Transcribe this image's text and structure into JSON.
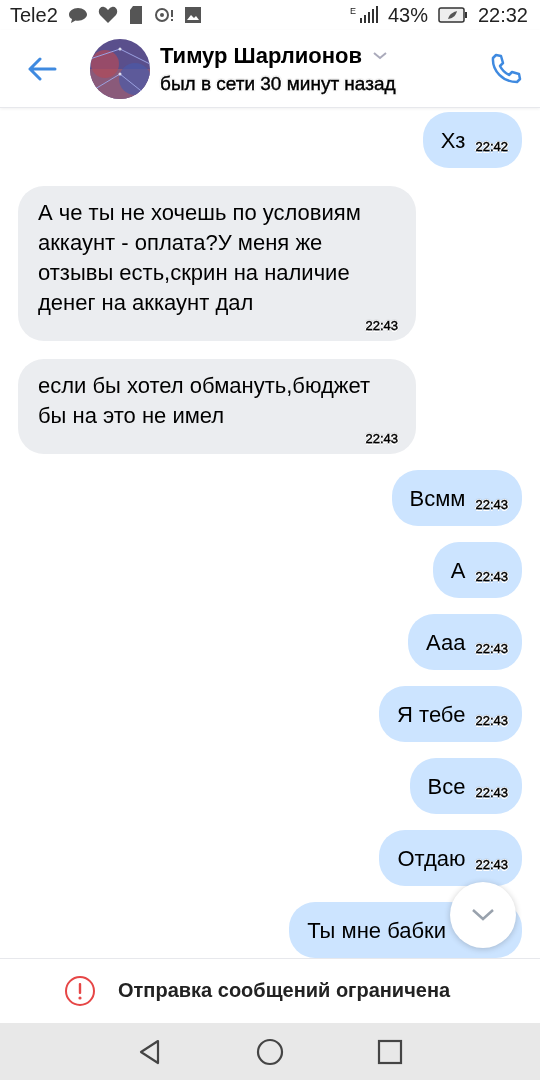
{
  "status_bar": {
    "carrier": "Tele2",
    "battery": "43%",
    "time": "22:32",
    "network": "E"
  },
  "header": {
    "name": "Тимур Шарлионов",
    "status": "был в сети 30 минут назад"
  },
  "messages": [
    {
      "outgoing": true,
      "text": "Хз",
      "time": "22:42"
    },
    {
      "outgoing": false,
      "text": "А че ты не хочешь по условиям аккаунт - оплата?У меня же отзывы есть,скрин на наличие денег на аккаунт дал",
      "time": "22:43"
    },
    {
      "outgoing": false,
      "text": "если бы хотел обмануть,бюджет бы на это не имел",
      "time": "22:43"
    },
    {
      "outgoing": true,
      "text": "Всмм",
      "time": "22:43"
    },
    {
      "outgoing": true,
      "text": "А",
      "time": "22:43"
    },
    {
      "outgoing": true,
      "text": "Ааа",
      "time": "22:43"
    },
    {
      "outgoing": true,
      "text": "Я тебе",
      "time": "22:43"
    },
    {
      "outgoing": true,
      "text": "Все",
      "time": "22:43"
    },
    {
      "outgoing": true,
      "text": "Отдаю",
      "time": "22:43"
    },
    {
      "outgoing": true,
      "text": "Ты мне бабки"
    }
  ],
  "notice": "Отправка сообщений ограничена"
}
